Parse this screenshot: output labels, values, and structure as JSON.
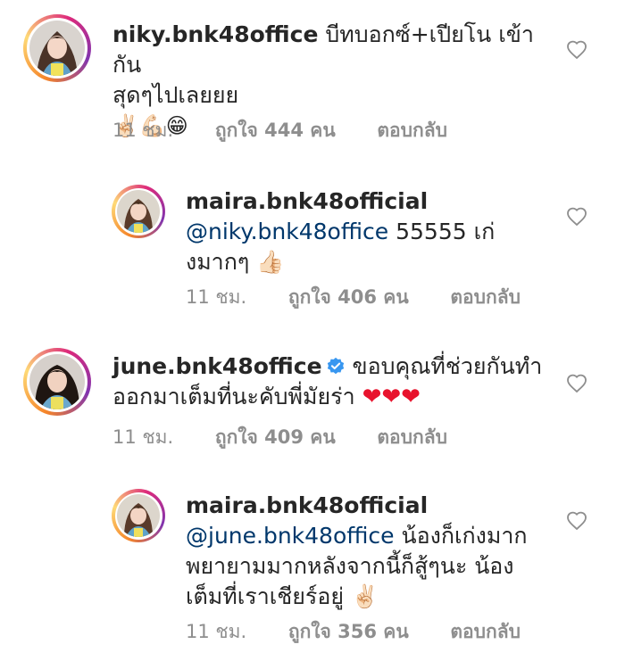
{
  "comments": [
    {
      "username": "niky.bnk48office",
      "text_line1": " บีทบอกซ์+เปียโน เข้ากัน",
      "text_line2": "สุดๆไปเลยยย",
      "emoji_line": "✌🏻💪🏻😁",
      "time": "11 ชม.",
      "likes": "ถูกใจ 444 คน",
      "reply": "ตอบกลับ"
    },
    {
      "username": "maira.bnk48official",
      "mention": "@niky.bnk48office",
      "text_line1": " 55555 เก่",
      "text_line2": "งมากๆ 👍🏻",
      "time": "11 ชม.",
      "likes": "ถูกใจ 406 คน",
      "reply": "ตอบกลับ"
    },
    {
      "username": "june.bnk48office",
      "text_line1": " ขอบคุณที่ช่วยกันทำ",
      "text_line2": "ออกมาเต็มที่นะคับพี่มัยร่า ",
      "hearts": "❤❤❤",
      "time": "11 ชม.",
      "likes": "ถูกใจ 409 คน",
      "reply": "ตอบกลับ"
    },
    {
      "username": "maira.bnk48official",
      "mention": "@june.bnk48office",
      "text_line1": " น้องก็เก่งมาก",
      "text_line2": "พยายามมากหลังจากนี้ก็สู้ๆนะ น้อง",
      "text_line3": "เต็มที่เราเชียร์อยู่ ✌🏻",
      "time": "11 ชม.",
      "likes": "ถูกใจ 356 คน",
      "reply": "ตอบกลับ"
    }
  ],
  "colors": {
    "text": "#262626",
    "meta": "#8e8e8e",
    "mention": "#00376b",
    "verified": "#3897f0",
    "heart_outline": "#8e8e8e"
  }
}
